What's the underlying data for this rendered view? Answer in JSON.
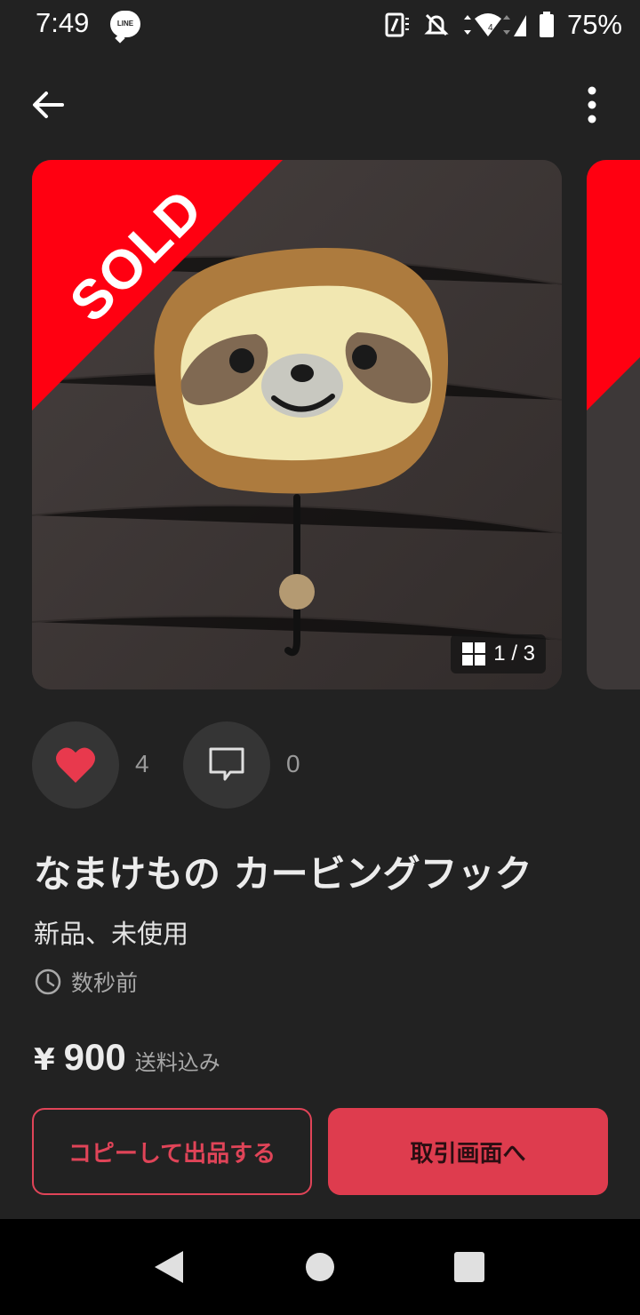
{
  "status_bar": {
    "time": "7:49",
    "line_badge": "LINE",
    "battery_percent": "75%"
  },
  "product": {
    "sold_label": "SOLD",
    "image_counter": "1 / 3",
    "likes_count": "4",
    "comments_count": "0",
    "title": "なまけもの カービングフック",
    "condition": "新品、未使用",
    "posted_time": "数秒前",
    "price_symbol": "¥",
    "price": "900",
    "shipping_note": "送料込み"
  },
  "buttons": {
    "copy_listing": "コピーして出品する",
    "go_to_transaction": "取引画面へ"
  },
  "colors": {
    "background": "#222222",
    "accent": "#de3c4e",
    "sold_red": "#ff0011",
    "heart": "#e8394d"
  },
  "icons": [
    "back-arrow-icon",
    "more-vert-icon",
    "grid-icon",
    "heart-icon",
    "comment-icon",
    "clock-icon",
    "nav-back-icon",
    "nav-home-icon",
    "nav-recents-icon"
  ]
}
